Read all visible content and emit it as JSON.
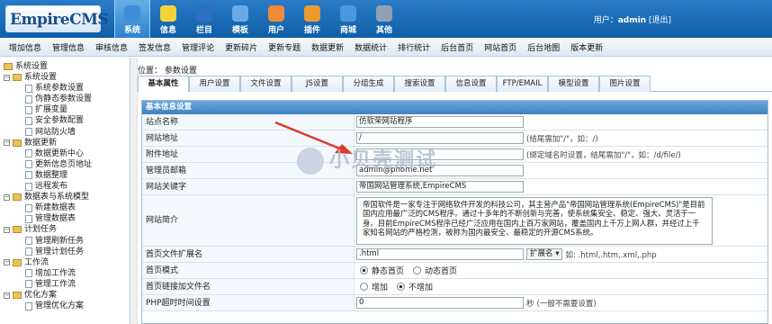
{
  "header": {
    "logo": "EmpireCMS",
    "nav": [
      {
        "label": "系统",
        "icon": "globe-icon",
        "active": true
      },
      {
        "label": "信息",
        "icon": "edit-icon"
      },
      {
        "label": "栏目",
        "icon": "folder-icon"
      },
      {
        "label": "模板",
        "icon": "template-icon"
      },
      {
        "label": "用户",
        "icon": "user-icon"
      },
      {
        "label": "插件",
        "icon": "tools-icon"
      },
      {
        "label": "商城",
        "icon": "shop-icon"
      },
      {
        "label": "其他",
        "icon": "gear-icon"
      }
    ],
    "user_prefix": "用户：",
    "user_name": "admin",
    "logout": "[退出]"
  },
  "menubar": [
    "增加信息",
    "管理信息",
    "审核信息",
    "签发信息",
    "管理评论",
    "更新碎片",
    "更新专题",
    "数据更新",
    "数据统计",
    "排行统计",
    "后台首页",
    "网站首页",
    "后台地图",
    "版本更新"
  ],
  "sidebar": {
    "groups": [
      {
        "label": "系统设置",
        "items": [],
        "root": true
      },
      {
        "label": "系统设置",
        "items": [
          "系统参数设置",
          "伪静态参数设置",
          "扩展变量",
          "安全参数配置",
          "网站防火墙"
        ]
      },
      {
        "label": "数据更新",
        "items": [
          "数据更新中心",
          "更新信息页地址",
          "数据整理",
          "远程发布"
        ]
      },
      {
        "label": "数据表与系统模型",
        "items": [
          "新建数据表",
          "管理数据表"
        ]
      },
      {
        "label": "计划任务",
        "items": [
          "管理刷新任务",
          "管理计划任务"
        ]
      },
      {
        "label": "工作流",
        "items": [
          "增加工作流",
          "管理工作流"
        ]
      },
      {
        "label": "优化方案",
        "items": [
          "管理优化方案"
        ]
      }
    ]
  },
  "breadcrumb": "位置： 参数设置",
  "tabs": [
    "基本属性",
    "用户设置",
    "文件设置",
    "JS设置",
    "分组生成",
    "搜索设置",
    "信息设置",
    "FTP/EMAIL",
    "模型设置",
    "图片设置"
  ],
  "panel": {
    "title": "基本信息设置",
    "rows": [
      {
        "label": "站点名称",
        "value": "仿软荣网站程序",
        "type": "input",
        "w": 186
      },
      {
        "label": "网站地址",
        "value": "/",
        "type": "input",
        "w": 186,
        "hint": "(结尾需加\"/\"，如：/)"
      },
      {
        "label": "附件地址",
        "value": "",
        "type": "input",
        "w": 186,
        "hint": "(绑定域名时设置，结尾需加\"/\"，如：/d/file/)"
      },
      {
        "label": "管理员邮箱",
        "value": "admin@phome.net",
        "type": "input",
        "w": 186
      },
      {
        "label": "网站关键字",
        "value": "帝国网站管理系统,EmpireCMS",
        "type": "input",
        "w": 186
      },
      {
        "label": "网站简介",
        "value": "帝国软件是一家专注于网络软件开发的科技公司，其主营产品\"帝国网站管理系统(EmpireCMS)\"是目前国内应用最广泛的CMS程序。通过十多年的不断创新与完善，使系统集安全、稳定、强大、灵活于一身。目前EmpireCMS程序已经广泛应用在国内上百万家网站，覆盖国内上千万上网人群，并经过上千家知名网站的严格检测，被称为国内最安全、最稳定的开源CMS系统。",
        "type": "textarea"
      },
      {
        "label": "首页文件扩展名",
        "value": ".html",
        "type": "ext",
        "select": "扩展名 ▾",
        "hint": "如: .html,.htm,.xml,.php"
      },
      {
        "label": "首页模式",
        "type": "radio",
        "options": [
          "静态首页",
          "动态首页"
        ],
        "selected": 0
      },
      {
        "label": "首页链接加文件名",
        "type": "radio",
        "options": [
          "增加",
          "不增加"
        ],
        "selected": 1
      },
      {
        "label": "PHP超时时间设置",
        "value": "0",
        "type": "input",
        "w": 186,
        "suffix": "秒",
        "hint": "(一般不需要设置)"
      }
    ]
  },
  "watermark": "小贝壳测试"
}
